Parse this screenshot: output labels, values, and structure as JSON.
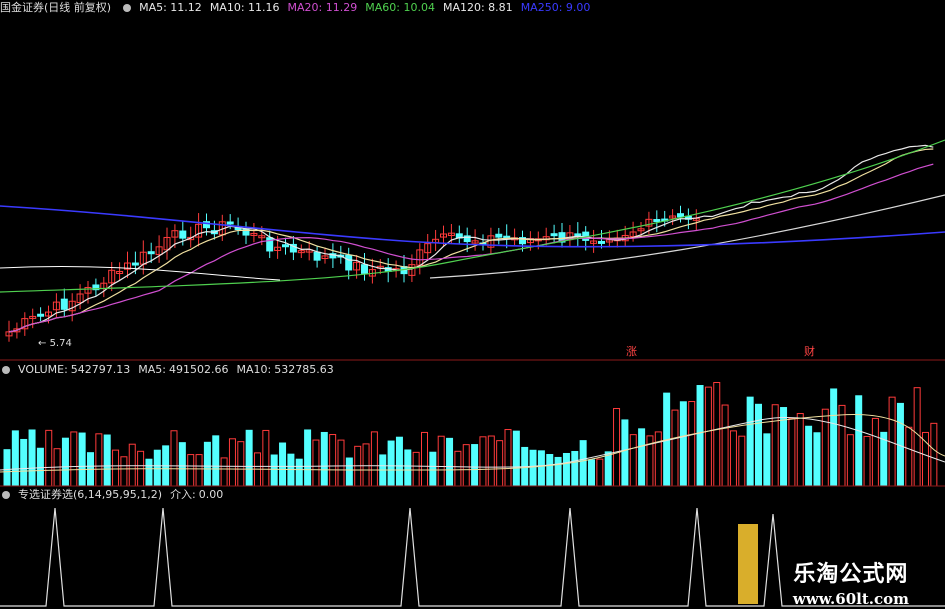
{
  "price_panel": {
    "stock_name": "国金证券",
    "period": "(日线 前复权)",
    "indicators": [
      {
        "label": "MA5:",
        "value": "11.12",
        "color": "#e8e8e8"
      },
      {
        "label": "MA10:",
        "value": "11.16",
        "color": "#e8e8e8"
      },
      {
        "label": "MA20:",
        "value": "11.29",
        "color": "#d04fd0"
      },
      {
        "label": "MA60:",
        "value": "10.04",
        "color": "#4fd04f"
      },
      {
        "label": "MA120:",
        "value": "8.81",
        "color": "#e8e8e8"
      },
      {
        "label": "MA250:",
        "value": "9.00",
        "color": "#3a3aff"
      }
    ],
    "low_label": "5.74",
    "tags": [
      "涨",
      "财"
    ]
  },
  "volume_panel": {
    "title": "VOLUME:",
    "value": "542797.13",
    "ma5_label": "MA5:",
    "ma5_value": "491502.66",
    "ma10_label": "MA10:",
    "ma10_value": "532785.63"
  },
  "signal_panel": {
    "title": "专选证券选(6,14,95,95,1,2)",
    "sub_label": "介入:",
    "sub_value": "0.00"
  },
  "watermark": {
    "title": "乐淘公式网",
    "url": "www.60lt.com"
  },
  "colors": {
    "up": "#ff3b3b",
    "down": "#54ffff",
    "ma5": "#e8e8e8",
    "ma20": "#d04fd0",
    "ma60": "#4fd04f",
    "ma250": "#3a3aff",
    "separator": "#8b1a1a"
  },
  "chart_data": [
    {
      "type": "candlestick",
      "title": "国金证券 (日线 前复权)",
      "series": [
        {
          "name": "MA5",
          "value": 11.12
        },
        {
          "name": "MA10",
          "value": 11.16
        },
        {
          "name": "MA20",
          "value": 11.29
        },
        {
          "name": "MA60",
          "value": 10.04
        },
        {
          "name": "MA120",
          "value": 8.81
        },
        {
          "name": "MA250",
          "value": 9.0
        }
      ],
      "annotations": [
        "5.74"
      ]
    },
    {
      "type": "bar",
      "title": "VOLUME",
      "series": [
        {
          "name": "VOLUME",
          "value": 542797.13
        },
        {
          "name": "MA5",
          "value": 491502.66
        },
        {
          "name": "MA10",
          "value": 532785.63
        }
      ]
    },
    {
      "type": "line",
      "title": "专选证券选(6,14,95,95,1,2)",
      "series": [
        {
          "name": "介入",
          "value": 0.0
        }
      ]
    }
  ]
}
